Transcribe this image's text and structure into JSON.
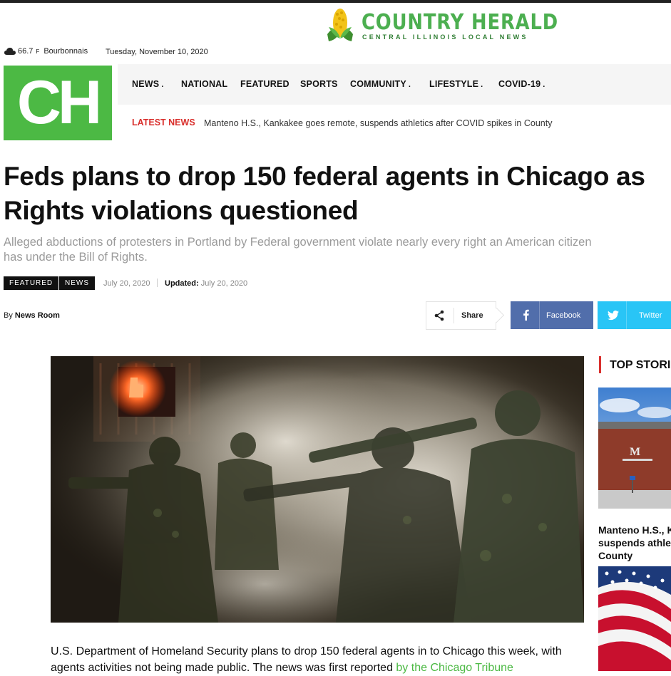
{
  "site": {
    "name": "COUNTRY HERALD",
    "tagline": "CENTRAL ILLINOIS LOCAL NEWS",
    "logo_letters": "CH",
    "brand_color": "#4cb944",
    "accent_color": "#d9302d"
  },
  "weather": {
    "icon": "cloud-icon",
    "temp": "66.7",
    "unit": "F",
    "location": "Bourbonnais"
  },
  "date": "Tuesday, November 10, 2020",
  "nav": {
    "items": [
      {
        "label": "NEWS",
        "dropdown": true
      },
      {
        "label": "NATIONAL",
        "dropdown": false
      },
      {
        "label": "FEATURED",
        "dropdown": false
      },
      {
        "label": "SPORTS",
        "dropdown": false
      },
      {
        "label": "COMMUNITY",
        "dropdown": true
      },
      {
        "label": "LIFESTYLE",
        "dropdown": true
      },
      {
        "label": "COVID-19",
        "dropdown": true
      }
    ],
    "dropdown_marker": "."
  },
  "ticker": {
    "label": "LATEST NEWS",
    "headline": "Manteno H.S., Kankakee goes remote, suspends athletics after COVID spikes in County"
  },
  "article": {
    "title_line1": "Feds plans to drop 150 federal agents in Chicago as",
    "title_line2": "Rights violations questioned",
    "subtitle": "Alleged abductions of protesters in Portland by Federal government violate nearly every right an American citizen has under the Bill of Rights.",
    "categories": [
      "FEATURED",
      "NEWS"
    ],
    "published": "July 20, 2020",
    "updated_label": "Updated:",
    "updated": "July 20, 2020",
    "by_label": "By",
    "author": "News Room",
    "body_start": "U.S. Department of Homeland Security plans to drop 150 federal agents in to Chicago this week, with agents activities not being made public. The news was first reported ",
    "body_link": "by the Chicago Tribune"
  },
  "share": {
    "label": "Share",
    "facebook": "Facebook",
    "twitter": "Twitter",
    "facebook_color": "#516eab",
    "twitter_color": "#29c5f6"
  },
  "sidebar": {
    "title": "TOP STORI",
    "story1": {
      "lines": [
        "Manteno H.S., K",
        "suspends athle",
        "County"
      ]
    }
  }
}
